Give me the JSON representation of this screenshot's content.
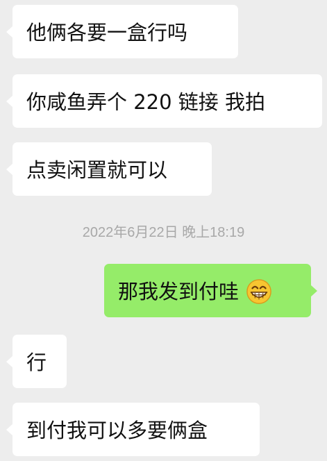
{
  "messages": [
    {
      "side": "in",
      "text": "他俩各要一盒行吗"
    },
    {
      "side": "in",
      "text": "你咸鱼弄个 220 链接 我拍"
    },
    {
      "side": "in",
      "text": "点卖闲置就可以"
    },
    {
      "timestamp": "2022年6月22日 晚上18:19"
    },
    {
      "side": "out",
      "text": "那我发到付哇",
      "emoji": "grinning-face-icon"
    },
    {
      "side": "in",
      "text": "行"
    },
    {
      "side": "in",
      "text": "到付我可以多要俩盒"
    }
  ],
  "colors": {
    "background": "#ededed",
    "incoming_bubble": "#ffffff",
    "outgoing_bubble": "#95ec69",
    "timestamp_text": "#a8a8a8"
  }
}
